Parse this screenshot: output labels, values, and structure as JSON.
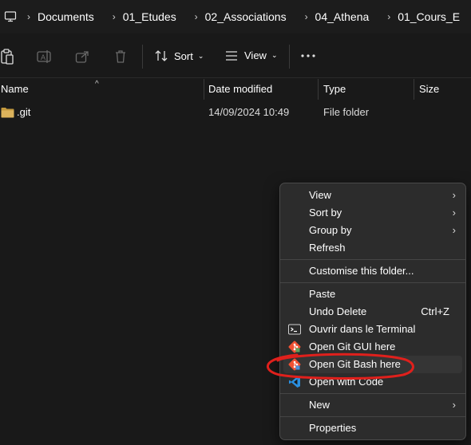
{
  "breadcrumb": {
    "items": [
      "Documents",
      "01_Etudes",
      "02_Associations",
      "04_Athena",
      "01_Cours_E"
    ]
  },
  "toolbar": {
    "sort_label": "Sort",
    "view_label": "View"
  },
  "columns": {
    "name": "Name",
    "date_modified": "Date modified",
    "type": "Type",
    "size": "Size"
  },
  "files": [
    {
      "name": ".git",
      "date_modified": "14/09/2024 10:49",
      "type": "File folder",
      "size": ""
    }
  ],
  "context_menu": {
    "view": "View",
    "sort_by": "Sort by",
    "group_by": "Group by",
    "refresh": "Refresh",
    "customise": "Customise this folder...",
    "paste": "Paste",
    "undo_delete": "Undo Delete",
    "undo_shortcut": "Ctrl+Z",
    "terminal": "Ouvrir dans le Terminal",
    "git_gui": "Open Git GUI here",
    "git_bash": "Open Git Bash here",
    "open_code": "Open with Code",
    "new": "New",
    "properties": "Properties"
  },
  "colors": {
    "background": "#191919",
    "menu_background": "#2c2c2c",
    "folder": "#dcb35c",
    "annotation": "#e0201c",
    "git": "#f05133",
    "vscode": "#2a8fe0"
  }
}
